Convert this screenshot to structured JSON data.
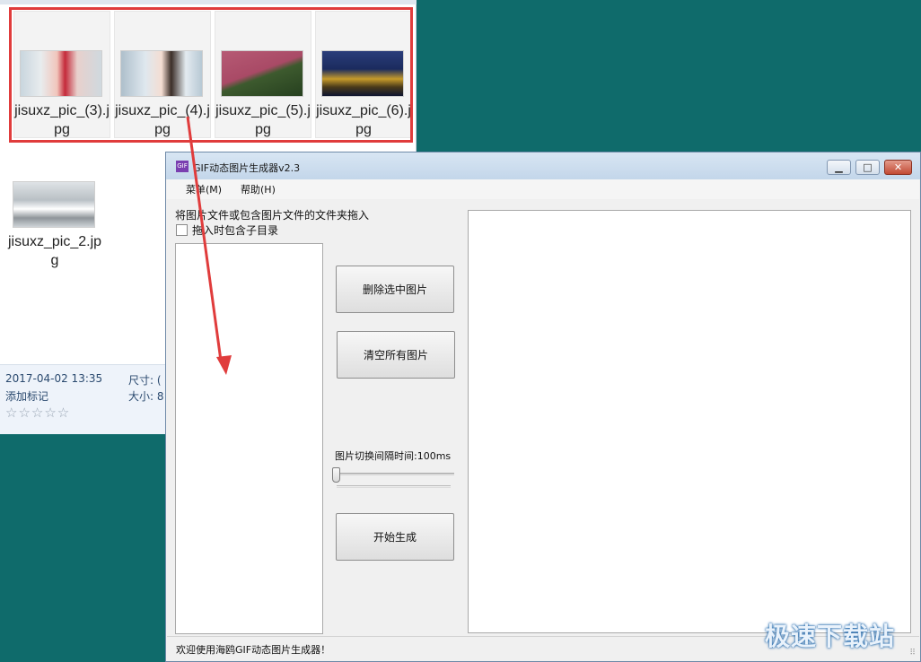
{
  "explorer": {
    "thumbnails": [
      {
        "label": "jisuxz_pic_(3).jpg",
        "icon": "photo-thumbnail"
      },
      {
        "label": "jisuxz_pic_(4).jpg",
        "icon": "photo-thumbnail"
      },
      {
        "label": "jisuxz_pic_(5).jpg",
        "icon": "photo-thumbnail"
      },
      {
        "label": "jisuxz_pic_(6).jpg",
        "icon": "photo-thumbnail"
      },
      {
        "label": "jisuxz_pic_2.jpg",
        "icon": "photo-thumbnail"
      }
    ],
    "details": {
      "date": "2017-04-02 13:35",
      "tag_label": "添加标记",
      "size_dim_label": "尺寸: (",
      "size_label": "大小: 8",
      "rating": "☆☆☆☆☆"
    },
    "selection_color": "#e03c3c"
  },
  "app": {
    "title": "GIF动态图片生成器v2.3",
    "icon_text": "GIF",
    "window_buttons": {
      "minimize": "▁",
      "maximize": "□",
      "close": "✕"
    },
    "menu": [
      "菜单(M)",
      "帮助(H)"
    ],
    "drop_hint": "将图片文件或包含图片文件的文件夹拖入",
    "include_subdirs_label": "拖入时包含子目录",
    "include_subdirs_checked": false,
    "delete_selected_label": "删除选中图片",
    "clear_all_label": "清空所有图片",
    "interval_label": "图片切换间隔时间:100ms",
    "interval_value_ms": 100,
    "start_label": "开始生成",
    "status_text": "欢迎使用海鸥GIF动态图片生成器！",
    "grip": "⠿"
  },
  "watermark": "极速下载站",
  "colors": {
    "desktop": "#0f6b6b",
    "arrow": "#e03c3c",
    "titlebar": "#c3d6ea"
  }
}
